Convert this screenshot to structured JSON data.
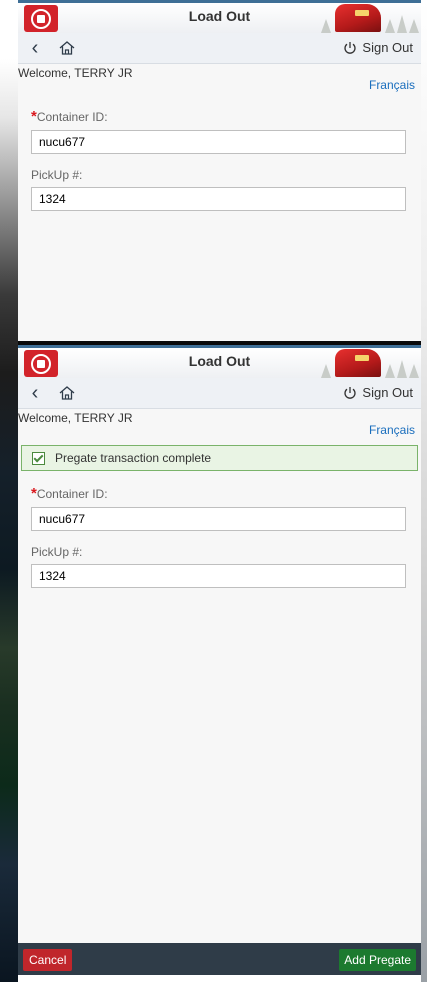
{
  "screens": [
    {
      "shell": {
        "title": "Load Out"
      },
      "nav": {
        "signout_label": "Sign Out"
      },
      "welcome": "Welcome, TERRY JR",
      "language": "Français",
      "alert": null,
      "form": {
        "container_label": "Container ID:",
        "container_value": "nucu677",
        "pickup_label": "PickUp #:",
        "pickup_value": "1324"
      }
    },
    {
      "shell": {
        "title": "Load Out"
      },
      "nav": {
        "signout_label": "Sign Out"
      },
      "welcome": "Welcome, TERRY JR",
      "language": "Français",
      "alert": "Pregate transaction complete",
      "form": {
        "container_label": "Container ID:",
        "container_value": "nucu677",
        "pickup_label": "PickUp #:",
        "pickup_value": "1324"
      },
      "footer": {
        "cancel_label": "Cancel",
        "add_label": "Add Pregate"
      }
    }
  ],
  "colors": {
    "brand_red": "#d2232a",
    "link_blue": "#1a6ebd",
    "success_green": "#1c7a2f",
    "footer_bg": "#2f3c48"
  },
  "icons": [
    "railway-logo-icon",
    "back-icon",
    "home-icon",
    "power-icon",
    "checkbox-icon"
  ]
}
